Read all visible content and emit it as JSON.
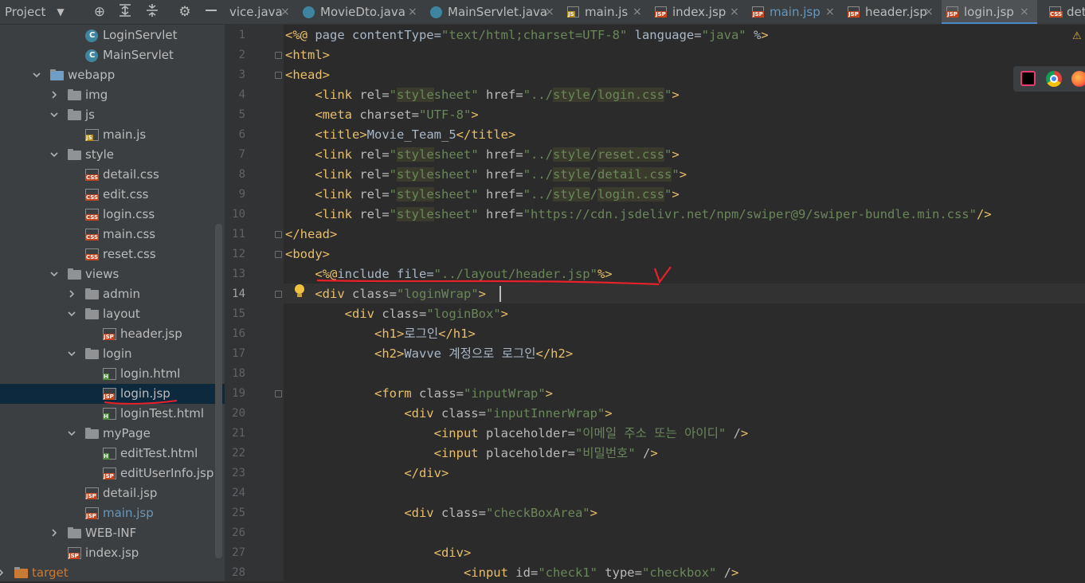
{
  "toolbar": {
    "project_label": "Project",
    "dropdown_glyph": "▼",
    "icons": [
      "target-icon",
      "expand-all-icon",
      "collapse-all-icon",
      "gear-icon",
      "minimize-icon"
    ]
  },
  "tabs": [
    {
      "label": "vice.java",
      "icon": "java-class-icon"
    },
    {
      "label": "MovieDto.java",
      "icon": "java-class-icon"
    },
    {
      "label": "MainServlet.java",
      "icon": "java-class-icon"
    },
    {
      "label": "main.js",
      "icon": "js-file-icon"
    },
    {
      "label": "index.jsp",
      "icon": "jsp-file-icon"
    },
    {
      "label": "main.jsp",
      "icon": "jsp-file-icon"
    },
    {
      "label": "header.jsp",
      "icon": "jsp-file-icon"
    },
    {
      "label": "login.jsp",
      "icon": "jsp-file-icon",
      "active": true
    },
    {
      "label": "deta",
      "icon": "css-file-icon"
    }
  ],
  "close_glyph": "×",
  "tree": [
    {
      "label": "LoginServlet",
      "kind": "class"
    },
    {
      "label": "MainServlet",
      "kind": "class"
    },
    {
      "label": "webapp",
      "kind": "webfolder",
      "expanded": true
    },
    {
      "label": "img",
      "kind": "folder",
      "expanded": false
    },
    {
      "label": "js",
      "kind": "folder",
      "expanded": true
    },
    {
      "label": "main.js",
      "kind": "js"
    },
    {
      "label": "style",
      "kind": "folder",
      "expanded": true
    },
    {
      "label": "detail.css",
      "kind": "css"
    },
    {
      "label": "edit.css",
      "kind": "css"
    },
    {
      "label": "login.css",
      "kind": "css"
    },
    {
      "label": "main.css",
      "kind": "css"
    },
    {
      "label": "reset.css",
      "kind": "css"
    },
    {
      "label": "views",
      "kind": "folder",
      "expanded": true
    },
    {
      "label": "admin",
      "kind": "folder",
      "expanded": false
    },
    {
      "label": "layout",
      "kind": "folder",
      "expanded": true
    },
    {
      "label": "header.jsp",
      "kind": "jsp"
    },
    {
      "label": "login",
      "kind": "folder",
      "expanded": true
    },
    {
      "label": "login.html",
      "kind": "html"
    },
    {
      "label": "login.jsp",
      "kind": "jsp",
      "selected": true
    },
    {
      "label": "loginTest.html",
      "kind": "html"
    },
    {
      "label": "myPage",
      "kind": "folder",
      "expanded": true
    },
    {
      "label": "editTest.html",
      "kind": "html"
    },
    {
      "label": "editUserInfo.jsp",
      "kind": "jsp"
    },
    {
      "label": "detail.jsp",
      "kind": "jsp"
    },
    {
      "label": "main.jsp",
      "kind": "jsp",
      "modified": true
    },
    {
      "label": "WEB-INF",
      "kind": "folder",
      "expanded": false
    },
    {
      "label": "index.jsp",
      "kind": "jsp"
    },
    {
      "label": "target",
      "kind": "target-folder",
      "expanded": false
    }
  ],
  "badges": {
    "js": "JS",
    "css": "CSS",
    "jsp": "JSP",
    "html": "H",
    "class": "C"
  },
  "editor": {
    "current_line": 14,
    "line_numbers": [
      "1",
      "2",
      "3",
      "4",
      "5",
      "6",
      "7",
      "8",
      "9",
      "10",
      "11",
      "12",
      "13",
      "14",
      "15",
      "16",
      "17",
      "18",
      "19",
      "20",
      "21",
      "22",
      "23",
      "24",
      "25",
      "26",
      "27",
      "28"
    ],
    "lines": [
      "<%@ page contentType=\"text/html;charset=UTF-8\" language=\"java\" %>",
      "<html>",
      "<head>",
      "    <link rel=\"stylesheet\" href=\"../style/login.css\">",
      "    <meta charset=\"UTF-8\">",
      "    <title>Movie_Team_5</title>",
      "    <link rel=\"stylesheet\" href=\"../style/reset.css\">",
      "    <link rel=\"stylesheet\" href=\"../style/detail.css\">",
      "    <link rel=\"stylesheet\" href=\"../style/login.css\">",
      "    <link rel=\"stylesheet\" href=\"https://cdn.jsdelivr.net/npm/swiper@9/swiper-bundle.min.css\"/>",
      "</head>",
      "<body>",
      "    <%@include file=\"../layout/header.jsp\"%>",
      "    <div class=\"loginWrap\">",
      "        <div class=\"loginBox\">",
      "            <h1>로그인</h1>",
      "            <h2>Wavve 계정으로 로그인</h2>",
      "",
      "            <form class=\"inputWrap\">",
      "                <div class=\"inputInnerWrap\">",
      "                    <input placeholder=\"이메일 주소 또는 아이디\" />",
      "                    <input placeholder=\"비밀번호\" />",
      "                </div>",
      "",
      "                <div class=\"checkBoxArea\">",
      "",
      "                    <div>",
      "                        <input id=\"check1\" type=\"checkbox\" />"
    ]
  },
  "annotations": {
    "checkmark": "V"
  },
  "browser_icons": [
    "intellij-icon",
    "chrome-icon",
    "firefox-icon"
  ],
  "colors": {
    "annotation": "#e8202a",
    "selection": "#0d293e",
    "accent": "#4a88c7"
  }
}
